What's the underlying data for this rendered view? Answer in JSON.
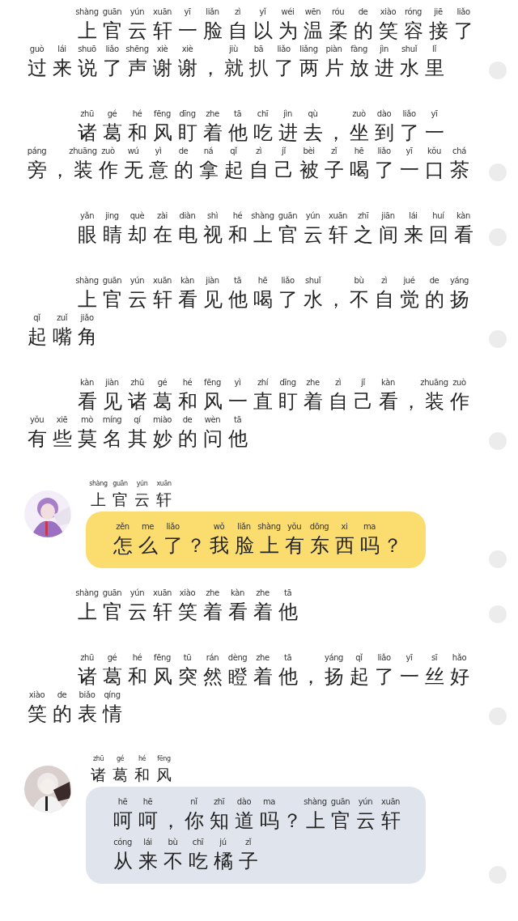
{
  "blocks": [
    {
      "kind": "narration",
      "lines": [
        [
          [
            "shàng",
            "上"
          ],
          [
            "guān",
            "官"
          ],
          [
            "yún",
            "云"
          ],
          [
            "xuān",
            "轩"
          ],
          [
            "yī",
            "一"
          ],
          [
            "liǎn",
            "脸"
          ],
          [
            "zì",
            "自"
          ],
          [
            "yǐ",
            "以"
          ],
          [
            "wéi",
            "为"
          ],
          [
            "wēn",
            "温"
          ],
          [
            "róu",
            "柔"
          ],
          [
            "de",
            "的"
          ],
          [
            "xiào",
            "笑"
          ],
          [
            "róng",
            "容"
          ],
          [
            "jiē",
            "接"
          ],
          [
            "liǎo",
            "了"
          ]
        ],
        [
          [
            "guò",
            "过"
          ],
          [
            "lái",
            "来"
          ],
          [
            "shuō",
            "说"
          ],
          [
            "liǎo",
            "了"
          ],
          [
            "shēng",
            "声"
          ],
          [
            "xiè",
            "谢"
          ],
          [
            "xiè",
            "谢"
          ],
          [
            "，"
          ],
          [
            "jiù",
            "就"
          ],
          [
            "bā",
            "扒"
          ],
          [
            "liǎo",
            "了"
          ],
          [
            "liǎng",
            "两"
          ],
          [
            "piàn",
            "片"
          ],
          [
            "fàng",
            "放"
          ],
          [
            "jìn",
            "进"
          ],
          [
            "shuǐ",
            "水"
          ],
          [
            "lǐ",
            "里"
          ]
        ]
      ]
    },
    {
      "kind": "narration",
      "lines": [
        [
          [
            "zhū",
            "诸"
          ],
          [
            "gé",
            "葛"
          ],
          [
            "hé",
            "和"
          ],
          [
            "fēng",
            "风"
          ],
          [
            "dīng",
            "盯"
          ],
          [
            "zhe",
            "着"
          ],
          [
            "tā",
            "他"
          ],
          [
            "chī",
            "吃"
          ],
          [
            "jìn",
            "进"
          ],
          [
            "qù",
            "去"
          ],
          [
            "，"
          ],
          [
            "zuò",
            "坐"
          ],
          [
            "dào",
            "到"
          ],
          [
            "liǎo",
            "了"
          ],
          [
            "yī",
            "一"
          ]
        ],
        [
          [
            "páng",
            "旁"
          ],
          [
            "，"
          ],
          [
            "zhuāng",
            "装"
          ],
          [
            "zuò",
            "作"
          ],
          [
            "wú",
            "无"
          ],
          [
            "yì",
            "意"
          ],
          [
            "de",
            "的"
          ],
          [
            "ná",
            "拿"
          ],
          [
            "qǐ",
            "起"
          ],
          [
            "zì",
            "自"
          ],
          [
            "jǐ",
            "己"
          ],
          [
            "bèi",
            "被"
          ],
          [
            "zǐ",
            "子"
          ],
          [
            "hē",
            "喝"
          ],
          [
            "liǎo",
            "了"
          ],
          [
            "yī",
            "一"
          ],
          [
            "kǒu",
            "口"
          ],
          [
            "chá",
            "茶"
          ]
        ]
      ]
    },
    {
      "kind": "narration",
      "lines": [
        [
          [
            "yǎn",
            "眼"
          ],
          [
            "jing",
            "睛"
          ],
          [
            "què",
            "却"
          ],
          [
            "zài",
            "在"
          ],
          [
            "diàn",
            "电"
          ],
          [
            "shì",
            "视"
          ],
          [
            "hé",
            "和"
          ],
          [
            "shàng",
            "上"
          ],
          [
            "guān",
            "官"
          ],
          [
            "yún",
            "云"
          ],
          [
            "xuān",
            "轩"
          ],
          [
            "zhī",
            "之"
          ],
          [
            "jiān",
            "间"
          ],
          [
            "lái",
            "来"
          ],
          [
            "huí",
            "回"
          ],
          [
            "kàn",
            "看"
          ]
        ]
      ]
    },
    {
      "kind": "narration",
      "lines": [
        [
          [
            "shàng",
            "上"
          ],
          [
            "guān",
            "官"
          ],
          [
            "yún",
            "云"
          ],
          [
            "xuān",
            "轩"
          ],
          [
            "kàn",
            "看"
          ],
          [
            "jiàn",
            "见"
          ],
          [
            "tā",
            "他"
          ],
          [
            "hē",
            "喝"
          ],
          [
            "liǎo",
            "了"
          ],
          [
            "shuǐ",
            "水"
          ],
          [
            "，"
          ],
          [
            "bù",
            "不"
          ],
          [
            "zì",
            "自"
          ],
          [
            "jué",
            "觉"
          ],
          [
            "de",
            "的"
          ],
          [
            "yáng",
            "扬"
          ]
        ],
        [
          [
            "qǐ",
            "起"
          ],
          [
            "zuǐ",
            "嘴"
          ],
          [
            "jiǎo",
            "角"
          ]
        ]
      ]
    },
    {
      "kind": "narration",
      "lines": [
        [
          [
            "kàn",
            "看"
          ],
          [
            "jiàn",
            "见"
          ],
          [
            "zhū",
            "诸"
          ],
          [
            "gé",
            "葛"
          ],
          [
            "hé",
            "和"
          ],
          [
            "fēng",
            "风"
          ],
          [
            "yì",
            "一"
          ],
          [
            "zhí",
            "直"
          ],
          [
            "dīng",
            "盯"
          ],
          [
            "zhe",
            "着"
          ],
          [
            "zì",
            "自"
          ],
          [
            "jǐ",
            "己"
          ],
          [
            "kàn",
            "看"
          ],
          [
            "，"
          ],
          [
            "zhuāng",
            "装"
          ],
          [
            "zuò",
            "作"
          ]
        ],
        [
          [
            "yǒu",
            "有"
          ],
          [
            "xiē",
            "些"
          ],
          [
            "mò",
            "莫"
          ],
          [
            "míng",
            "名"
          ],
          [
            "qí",
            "其"
          ],
          [
            "miào",
            "妙"
          ],
          [
            "de",
            "的"
          ],
          [
            "wèn",
            "问"
          ],
          [
            "tā",
            "他"
          ]
        ]
      ]
    },
    {
      "kind": "message",
      "color": "#fbdc6f",
      "speaker": [
        [
          "shàng",
          "上"
        ],
        [
          "guān",
          "官"
        ],
        [
          "yún",
          "云"
        ],
        [
          "xuān",
          "轩"
        ]
      ],
      "lines": [
        [
          [
            "zěn",
            "怎"
          ],
          [
            "me",
            "么"
          ],
          [
            "liǎo",
            "了"
          ],
          [
            "？"
          ],
          [
            "wǒ",
            "我"
          ],
          [
            "liǎn",
            "脸"
          ],
          [
            "shàng",
            "上"
          ],
          [
            "yǒu",
            "有"
          ],
          [
            "dōng",
            "东"
          ],
          [
            "xi",
            "西"
          ],
          [
            "ma",
            "吗"
          ],
          [
            "？"
          ]
        ]
      ]
    },
    {
      "kind": "narration",
      "lines": [
        [
          [
            "shàng",
            "上"
          ],
          [
            "guān",
            "官"
          ],
          [
            "yún",
            "云"
          ],
          [
            "xuān",
            "轩"
          ],
          [
            "xiào",
            "笑"
          ],
          [
            "zhe",
            "着"
          ],
          [
            "kàn",
            "看"
          ],
          [
            "zhe",
            "着"
          ],
          [
            "tā",
            "他"
          ]
        ]
      ]
    },
    {
      "kind": "narration",
      "lines": [
        [
          [
            "zhū",
            "诸"
          ],
          [
            "gé",
            "葛"
          ],
          [
            "hé",
            "和"
          ],
          [
            "fēng",
            "风"
          ],
          [
            "tū",
            "突"
          ],
          [
            "rán",
            "然"
          ],
          [
            "dèng",
            "瞪"
          ],
          [
            "zhe",
            "着"
          ],
          [
            "tā",
            "他"
          ],
          [
            "，"
          ],
          [
            "yáng",
            "扬"
          ],
          [
            "qǐ",
            "起"
          ],
          [
            "liǎo",
            "了"
          ],
          [
            "yī",
            "一"
          ],
          [
            "sī",
            "丝"
          ],
          [
            "hǎo",
            "好"
          ]
        ],
        [
          [
            "xiào",
            "笑"
          ],
          [
            "de",
            "的"
          ],
          [
            "biǎo",
            "表"
          ],
          [
            "qíng",
            "情"
          ]
        ]
      ]
    },
    {
      "kind": "message",
      "color": "#dfe4ed",
      "speaker": [
        [
          "zhū",
          "诸"
        ],
        [
          "gé",
          "葛"
        ],
        [
          "hé",
          "和"
        ],
        [
          "fēng",
          "风"
        ]
      ],
      "lines": [
        [
          [
            "hē",
            "呵"
          ],
          [
            "hē",
            "呵"
          ],
          [
            "，"
          ],
          [
            "nǐ",
            "你"
          ],
          [
            "zhī",
            "知"
          ],
          [
            "dào",
            "道"
          ],
          [
            "ma",
            "吗"
          ],
          [
            "？"
          ],
          [
            "shàng",
            "上"
          ],
          [
            "guān",
            "官"
          ],
          [
            "yún",
            "云"
          ],
          [
            "xuān",
            "轩"
          ]
        ],
        [
          [
            "cóng",
            "从"
          ],
          [
            "lái",
            "来"
          ],
          [
            "bù",
            "不"
          ],
          [
            "chī",
            "吃"
          ],
          [
            "jú",
            "橘"
          ],
          [
            "zǐ",
            "子"
          ]
        ]
      ]
    }
  ]
}
